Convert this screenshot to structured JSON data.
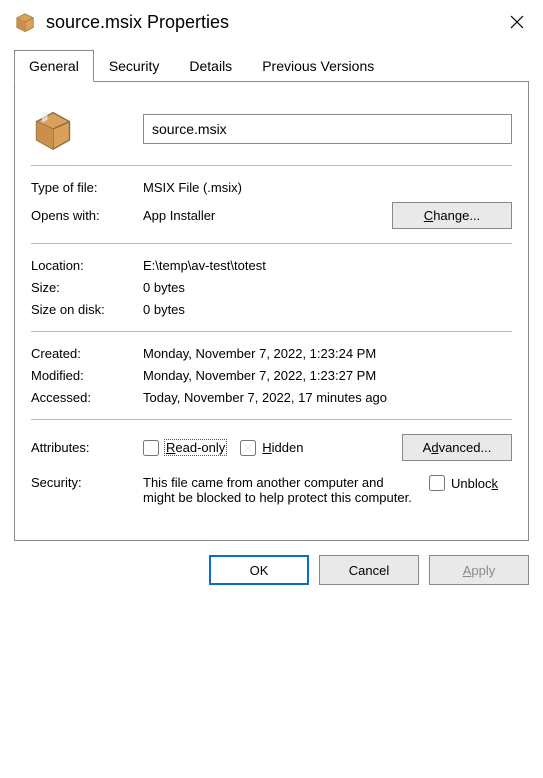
{
  "title": "source.msix Properties",
  "tabs": {
    "general": "General",
    "security": "Security",
    "details": "Details",
    "previous": "Previous Versions"
  },
  "filename": "source.msix",
  "labels": {
    "typeOfFile": "Type of file:",
    "opensWith": "Opens with:",
    "location": "Location:",
    "size": "Size:",
    "sizeOnDisk": "Size on disk:",
    "created": "Created:",
    "modified": "Modified:",
    "accessed": "Accessed:",
    "attributes": "Attributes:",
    "security": "Security:"
  },
  "values": {
    "typeOfFile": "MSIX File (.msix)",
    "opensWith": "App Installer",
    "location": "E:\\temp\\av-test\\totest",
    "size": "0 bytes",
    "sizeOnDisk": "0 bytes",
    "created": "Monday, November 7, 2022, 1:23:24 PM",
    "modified": "Monday, November 7, 2022, 1:23:27 PM",
    "accessed": "Today, November 7, 2022, 17 minutes ago",
    "securityText": "This file came from another computer and might be blocked to help protect this computer."
  },
  "buttons": {
    "change": "Change...",
    "advanced": "Advanced...",
    "ok": "OK",
    "cancel": "Cancel",
    "apply": "Apply"
  },
  "attributes": {
    "readonly": "Read-only",
    "hidden": "Hidden",
    "unblock": "Unblock"
  }
}
